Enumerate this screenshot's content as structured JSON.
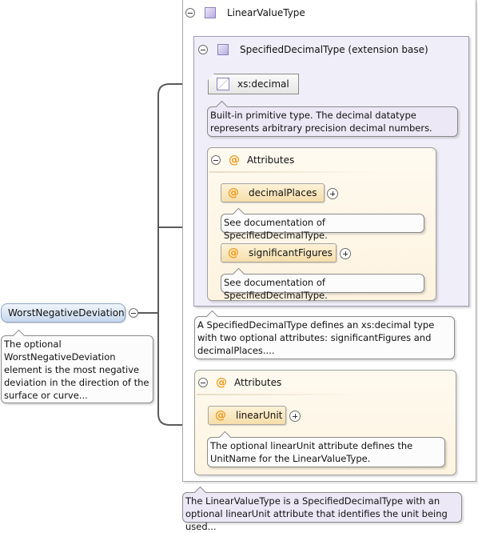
{
  "root_element": {
    "name": "WorstNegativeDeviation",
    "documentation": "The optional WorstNegativeDeviation element is the most negative deviation in the direction of the surface or curve..."
  },
  "complex_type": {
    "name": "LinearValueType",
    "documentation": "The LinearValueType is a SpecifiedDecimalType with an optional linearUnit attribute that identifies the unit being used..."
  },
  "extension": {
    "name": "SpecifiedDecimalType (extension base)",
    "documentation": "A SpecifiedDecimalType defines an xs:decimal type with two optional attributes: significantFigures and decimalPlaces....",
    "base_type": {
      "name": "xs:decimal",
      "documentation": "Built-in primitive type. The decimal datatype represents arbitrary precision decimal numbers."
    },
    "attributes_group": {
      "title": "Attributes",
      "items": [
        {
          "name": "decimalPlaces",
          "documentation": "See documentation of SpecifiedDecimalType."
        },
        {
          "name": "significantFigures",
          "documentation": "See documentation of SpecifiedDecimalType."
        }
      ]
    }
  },
  "own_attributes": {
    "title": "Attributes",
    "items": [
      {
        "name": "linearUnit",
        "documentation": "The optional linearUnit attribute defines the UnitName for the LinearValueType."
      }
    ]
  },
  "icons": {
    "attribute_symbol": "@",
    "collapse": "minus-circle",
    "expand": "plus-circle",
    "complex_type": "purple-square",
    "simple_type": "simple-type-square"
  },
  "colors": {
    "element_fill": "#c7d8ee",
    "extension_fill": "#f0eef8",
    "attribute_fill": "#f6deaa",
    "attribute_symbol": "#f09a1a"
  }
}
